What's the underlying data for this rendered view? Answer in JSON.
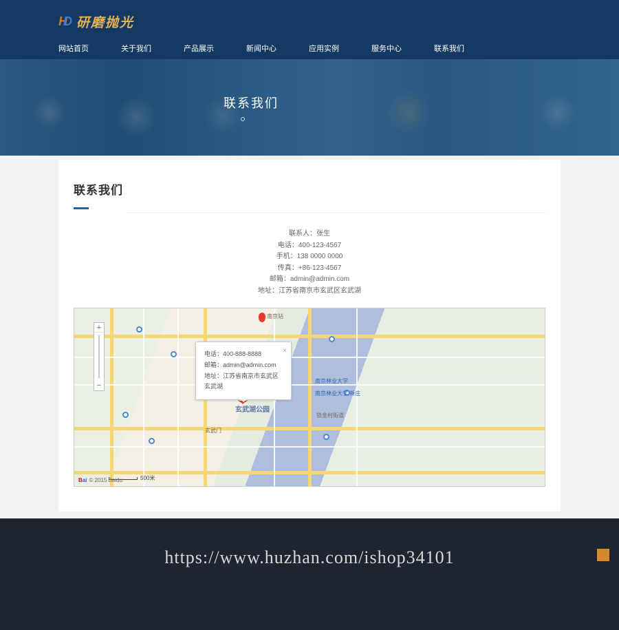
{
  "logo": {
    "text": "研磨抛光"
  },
  "nav": [
    "网站首页",
    "关于我们",
    "产品展示",
    "新闻中心",
    "应用实例",
    "服务中心",
    "联系我们"
  ],
  "hero": {
    "title": "联系我们"
  },
  "section": {
    "title": "联系我们"
  },
  "contact": {
    "line1": "联系人：张生",
    "line2": "电话：400-123-4567",
    "line3": "手机：138 0000 0000",
    "line4": "传真：+86-123-4567",
    "line5": "邮箱：admin@admin.com",
    "line6": "地址：江苏省南京市玄武区玄武湖"
  },
  "map": {
    "popup": {
      "phone": "电话：400-888-8888",
      "email": "邮箱：admin@admin.com",
      "address": "地址：江苏省南京市玄武区玄武湖"
    },
    "lake_label": "玄武湖公园",
    "gate_label": "玄武门",
    "station_label": "南京站",
    "uni1": "南京林业大学",
    "uni2": "南京林业大学 新庄",
    "area_r": "锁金村街道",
    "copy": "© 2015 Baidu",
    "scale": "500米"
  },
  "footer": {
    "url": "https://www.huzhan.com/ishop34101"
  }
}
